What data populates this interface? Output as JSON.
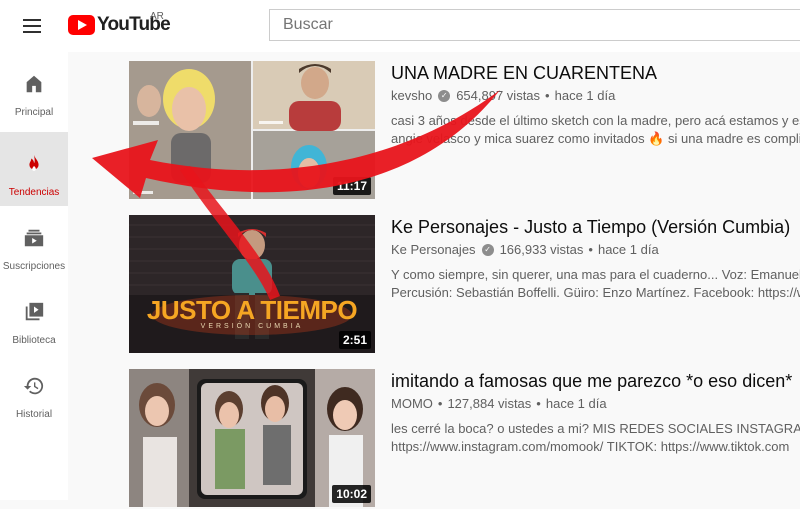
{
  "header": {
    "logo_text": "YouTube",
    "region": "AR",
    "search_placeholder": "Buscar"
  },
  "sidebar": {
    "items": [
      {
        "label": "Principal",
        "icon": "home-icon",
        "active": false
      },
      {
        "label": "Tendencias",
        "icon": "fire-icon",
        "active": true
      },
      {
        "label": "Suscripciones",
        "icon": "subscriptions-icon",
        "active": false
      },
      {
        "label": "Biblioteca",
        "icon": "library-icon",
        "active": false
      },
      {
        "label": "Historial",
        "icon": "history-icon",
        "active": false
      }
    ]
  },
  "videos": [
    {
      "title": "UNA MADRE EN CUARENTENA",
      "channel": "kevsho",
      "verified": true,
      "views": "654,897 vistas",
      "age": "hace 1 día",
      "duration": "11:17",
      "desc_line1": "casi 3 años desde el último sketch con la madre, pero acá estamos y es",
      "desc_line2": "angie velasco y mica suarez como invitados 🔥 si una madre es complic"
    },
    {
      "title": "Ke Personajes - Justo a Tiempo (Versión Cumbia)",
      "channel": "Ke Personajes",
      "verified": true,
      "views": "166,933 vistas",
      "age": "hace 1 día",
      "duration": "2:51",
      "thumb_title": "JUSTO A TIEMPO",
      "thumb_subtitle": "VERSIÓN CUMBIA",
      "desc_line1": "Y como siempre, sin querer, una mas para el cuaderno... Voz: Emanuel N",
      "desc_line2": "Percusión: Sebastián Boffelli. Güiro: Enzo Martínez. Facebook: https://w"
    },
    {
      "title": "imitando a famosas que me parezco *o eso dicen*",
      "channel": "MOMO",
      "verified": false,
      "views": "127,884 vistas",
      "age": "hace 1 día",
      "duration": "10:02",
      "desc_line1": "les cerré la boca? o ustedes a mi? MIS REDES SOCIALES INSTAGRAM:",
      "desc_line2": "https://www.instagram.com/momook/ TIKTOK: https://www.tiktok.com"
    }
  ],
  "colors": {
    "accent": "#ff0000",
    "active_label": "#cc0000",
    "annotation_arrow": "#e8141b"
  }
}
